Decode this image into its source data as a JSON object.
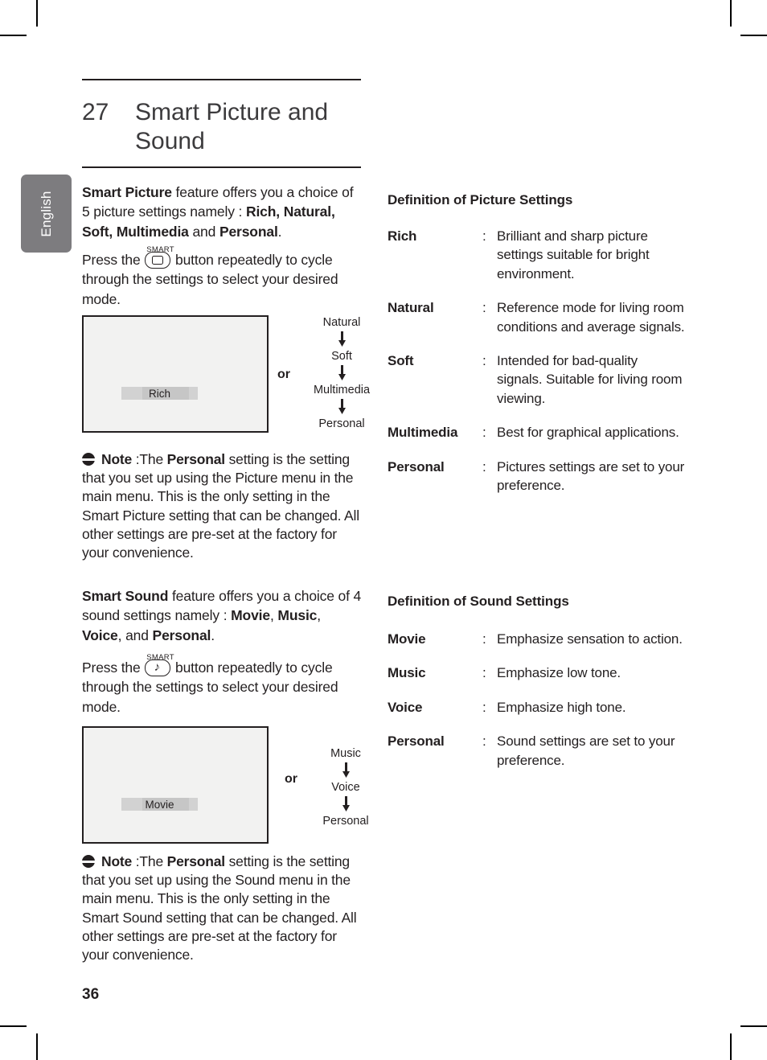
{
  "sidebar": {
    "language_label": "English"
  },
  "chapter": {
    "number": "27",
    "title": "Smart Picture and Sound"
  },
  "picture": {
    "intro": {
      "b1": "Smart Picture",
      "t1": " feature offers you a choice of 5 picture settings namely : ",
      "b2": "Rich, Natural, Soft, Multimedia",
      "t2": " and ",
      "b3": "Personal",
      "t3": "."
    },
    "press": {
      "before": "Press the ",
      "button_label": "SMART",
      "button_icon": "screen-icon",
      "after": " button repeatedly to cycle through the settings to select your desired mode."
    },
    "screen_mode": "Rich",
    "or_label": "or",
    "cycle": [
      "Natural",
      "Soft",
      "Multimedia",
      "Personal"
    ],
    "note": {
      "title": "Note",
      "colon": " :",
      "s1": "The ",
      "b1": "Personal",
      "s2": " setting is the setting that you set up using the Picture menu in the main menu. This is the only setting in the Smart Picture setting that can be changed. All other settings are pre-set at the factory for your convenience."
    }
  },
  "sound": {
    "intro": {
      "b1": "Smart Sound",
      "t1": " feature offers you a choice of 4 sound settings namely : ",
      "b2": "Movie",
      "t2": ", ",
      "b3": "Music",
      "t3": ", ",
      "b4": "Voice",
      "t4": ", and ",
      "b5": "Personal",
      "t5": "."
    },
    "press": {
      "before": "Press the ",
      "button_label": "SMART",
      "button_icon": "music-note-icon",
      "glyph": "♪",
      "after": " button repeatedly to cycle through the settings to select your desired mode."
    },
    "screen_mode": "Movie",
    "or_label": "or",
    "cycle": [
      "Music",
      "Voice",
      "Personal"
    ],
    "note": {
      "title": "Note",
      "colon": " :",
      "s1": "The ",
      "b1": "Personal",
      "s2": " setting is the setting that you set up using the Sound menu in the main menu. This is the only setting in the Smart Sound setting that can be changed. All other settings are pre-set at the factory for your convenience."
    }
  },
  "picture_settings": {
    "heading": "Definition of Picture Settings",
    "colon": ":",
    "rows": [
      {
        "term": "Rich",
        "desc": "Brilliant and sharp picture settings suitable for bright environment."
      },
      {
        "term": "Natural",
        "desc": "Reference mode for living room conditions and average signals."
      },
      {
        "term": "Soft",
        "desc": "Intended for bad-quality signals. Suitable for living room viewing."
      },
      {
        "term": "Multimedia",
        "desc": "Best for graphical applications."
      },
      {
        "term": "Personal",
        "desc": "Pictures settings are set to your preference."
      }
    ]
  },
  "sound_settings": {
    "heading": "Definition of Sound Settings",
    "colon": ":",
    "rows": [
      {
        "term": "Movie",
        "desc": "Emphasize sensation to action."
      },
      {
        "term": "Music",
        "desc": "Emphasize low tone."
      },
      {
        "term": "Voice",
        "desc": "Emphasize high tone."
      },
      {
        "term": "Personal",
        "desc": "Sound settings are set to your preference."
      }
    ]
  },
  "footer": {
    "page_number": "36"
  },
  "colors": {
    "tab_gray": "#7d7c7f",
    "screen_fill": "#f2f2f1",
    "band_gray": "#d2d2d2",
    "ink": "#231f20"
  }
}
